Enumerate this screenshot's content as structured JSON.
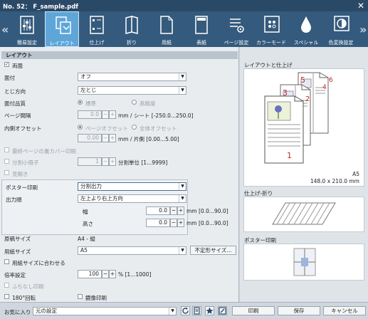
{
  "window": {
    "title": "No. 52：  F_sample.pdf",
    "close": "✕"
  },
  "toolbar": {
    "left_arrow": "«",
    "right_arrow": "»",
    "tabs": [
      {
        "label": "簡易設定",
        "icon": "sliders-icon"
      },
      {
        "label": "レイアウト",
        "icon": "layout-icon"
      },
      {
        "label": "仕上げ",
        "icon": "finishing-icon"
      },
      {
        "label": "折り",
        "icon": "fold-icon"
      },
      {
        "label": "用紙",
        "icon": "paper-icon"
      },
      {
        "label": "表紙",
        "icon": "cover-icon"
      },
      {
        "label": "ページ設定",
        "icon": "page-settings-icon"
      },
      {
        "label": "カラーモード",
        "icon": "palette-icon"
      },
      {
        "label": "スペシャル",
        "icon": "drop-icon"
      },
      {
        "label": "色変換設定",
        "icon": "color-convert-icon"
      }
    ],
    "active_index": 1
  },
  "layout": {
    "section_title": "レイアウト",
    "duplex": {
      "label": "両面",
      "checked": true
    },
    "binding": {
      "label": "面付",
      "value": "オフ"
    },
    "binding_dir": {
      "label": "とじ方向",
      "value": "左とじ"
    },
    "imposition_quality": {
      "label": "面付品質",
      "opt1": "標準",
      "opt2": "高精度",
      "selected": 1
    },
    "page_spacing": {
      "label": "ページ間隔",
      "value": "0.0",
      "minus": "−",
      "plus": "+",
      "unit": "mm / シート [-250.0...250.0]"
    },
    "inner_offset": {
      "label": "内側オフセット",
      "opt1": "ページオフセット",
      "opt2": "全体オフセット",
      "selected": 1,
      "value": "0.00",
      "unit": "mm / 片側 [0.00...5.00]"
    },
    "last_page_back_cover": {
      "label": "最終ページの裏カバー印刷",
      "checked": false
    },
    "split_booklet": {
      "label": "分割小冊子",
      "value": "1",
      "unit": "分割単位 [1...9999]",
      "checked": false
    },
    "spread": {
      "label": "見開き",
      "checked": false
    },
    "poster_print": {
      "label": "ポスター印刷",
      "value": "分割出力"
    },
    "output_order": {
      "label": "出力順",
      "value": "左上より右上方向"
    },
    "width": {
      "label": "幅",
      "value": "0.0",
      "unit": "mm [0.0...90.0]"
    },
    "height": {
      "label": "高さ",
      "value": "0.0",
      "unit": "mm [0.0...90.0]"
    },
    "original_size": {
      "label": "原稿サイズ",
      "value": "A4 - 縦"
    },
    "paper_size": {
      "label": "用紙サイズ",
      "value": "A5",
      "button": "不定形サイズ..."
    },
    "fit_to_paper": {
      "label": "用紙サイズに合わせる",
      "checked": false
    },
    "zoom": {
      "label": "倍率設定",
      "value": "100",
      "unit": "% [1...1000]"
    },
    "borderless": {
      "label": "ふちなし印刷",
      "checked": false
    },
    "rotate180": {
      "label": "180°回転",
      "checked": false
    },
    "mirror": {
      "label": "鏡像印刷",
      "checked": false
    }
  },
  "preview": {
    "layout_title": "レイアウトと仕上げ",
    "paper_name": "A5",
    "paper_dims": "148.0 x 210.0 mm",
    "page_numbers": [
      "1",
      "2",
      "3",
      "4",
      "5",
      "6"
    ],
    "finish_title": "仕上げ-折り",
    "poster_title": "ポスター印刷"
  },
  "bottom": {
    "favorites_label": "お気に入り",
    "favorites_value": "元の設定",
    "print": "印刷",
    "save": "保存",
    "cancel": "キャンセル"
  },
  "colors": {
    "titlebar": "#2a4966",
    "toolbar": "#345a7d",
    "active_tab": "#5fa6d8",
    "page_number_red": "#c0282d"
  }
}
